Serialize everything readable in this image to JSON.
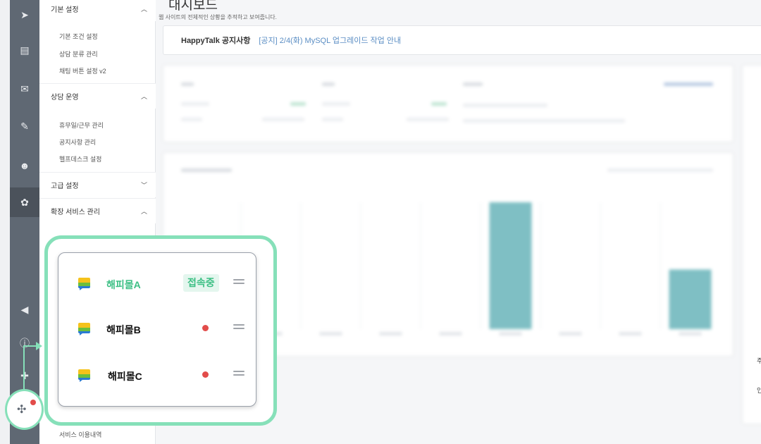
{
  "colors": {
    "accent": "#3cbf84",
    "callout": "#86e0b9",
    "alert": "#e24c4a",
    "chart_bar": "#7fbfc4",
    "rail": "#5f6873"
  },
  "rail": {
    "items": [
      {
        "name": "send-icon",
        "glyph": "➤"
      },
      {
        "name": "list-icon",
        "glyph": "▤"
      },
      {
        "name": "mail-icon",
        "glyph": "✉"
      },
      {
        "name": "chat-icon",
        "glyph": "✎"
      },
      {
        "name": "bot-icon",
        "glyph": "☻"
      },
      {
        "name": "gear-icon",
        "glyph": "✿"
      },
      {
        "name": "megaphone-icon",
        "glyph": "◀"
      },
      {
        "name": "info-icon",
        "glyph": "ⓘ"
      },
      {
        "name": "puzzle-icon",
        "glyph": "✚"
      },
      {
        "name": "shop-switch-icon",
        "glyph": "✣"
      }
    ]
  },
  "menu": {
    "basic": {
      "title": "기본 설정",
      "items": [
        "기본 조건 설정",
        "상담 분류 관리",
        "채팅 버튼 설정 v2"
      ]
    },
    "ops": {
      "title": "상담 운영",
      "items": [
        "휴무일/근무 관리",
        "공지사항 관리",
        "헬프데스크 설정"
      ]
    },
    "advanced": {
      "title": "고급 설정"
    },
    "extension": {
      "title": "확장 서비스 관리"
    },
    "bottom_item": "서비스 이용내역"
  },
  "main": {
    "title": "대시보드",
    "subtitle": "웹 사이트의 전체적인 상황을 추적하고 보여줍니다.",
    "notice": {
      "label": "HappyTalk 공지사항",
      "link": "[공지] 2/4(화) MySQL 업그레이드 작업 안내"
    }
  },
  "chart_data": {
    "type": "bar",
    "categories": [
      "",
      "",
      "",
      "",
      "",
      "",
      "",
      ""
    ],
    "values": [
      0,
      0,
      0,
      0,
      100,
      0,
      0,
      47
    ],
    "title": "",
    "xlabel": "",
    "ylabel": "",
    "ylim": [
      0,
      100
    ]
  },
  "shops": [
    {
      "name": "해피몰A",
      "status": "접속중",
      "connected": true
    },
    {
      "name": "해피몰B",
      "status": "",
      "connected": false
    },
    {
      "name": "해피몰C",
      "status": "",
      "connected": false
    }
  ]
}
